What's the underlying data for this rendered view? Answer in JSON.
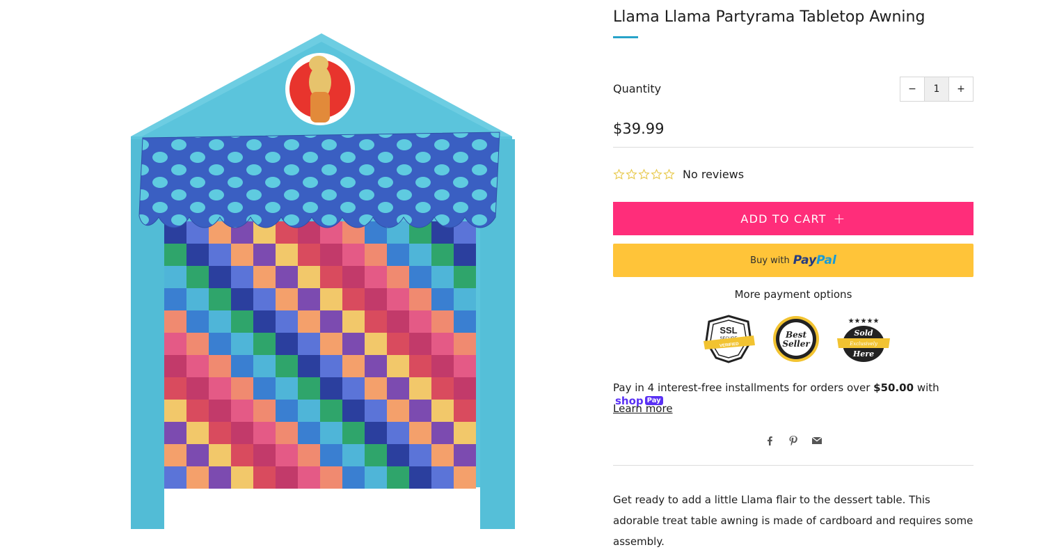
{
  "product": {
    "title": "Llama Llama Partyrama Tabletop Awning",
    "price": "$39.99",
    "reviews_text": "No reviews",
    "rating": 0,
    "rating_max": 5
  },
  "quantity": {
    "label": "Quantity",
    "value": "1",
    "decrement": "−",
    "increment": "+"
  },
  "buttons": {
    "add_to_cart": "ADD TO CART",
    "add_to_cart_icon": "+",
    "paypal_prefix": "Buy with",
    "paypal_brand_1": "Pay",
    "paypal_brand_2": "Pal",
    "more_payment_options": "More payment options"
  },
  "badges": [
    {
      "name": "ssl-secure-badge",
      "lines": [
        "SSL",
        "SECURE",
        "VERIFIED"
      ]
    },
    {
      "name": "best-seller-badge",
      "lines": [
        "Best",
        "Seller"
      ]
    },
    {
      "name": "sold-exclusively-badge",
      "lines": [
        "Sold",
        "Exclusively",
        "Here"
      ]
    }
  ],
  "installments": {
    "text_before": "Pay in 4 interest-free installments for orders over ",
    "amount": "$50.00",
    "text_after": " with ",
    "shop_label": "shop",
    "pay_label": "Pay",
    "learn_more": "Learn more"
  },
  "share_icons": [
    "facebook-icon",
    "pinterest-icon",
    "email-icon"
  ],
  "description": "Get ready to add a little Llama flair to the dessert table.  This adorable treat table awning is made of cardboard and requires some assembly.",
  "colors": {
    "accent_blue": "#27a3c9",
    "add_to_cart": "#ff2d7a",
    "paypal": "#ffc439",
    "shop_pay": "#5a31f4",
    "star_outline": "#e8c94b"
  }
}
